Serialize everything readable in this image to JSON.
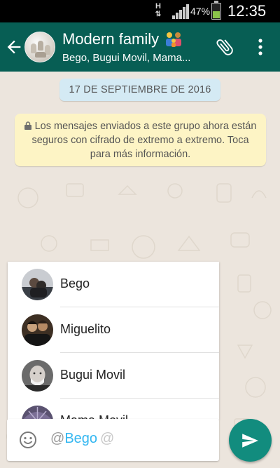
{
  "status_bar": {
    "network": "H",
    "network_arrows": "⇅",
    "battery_percent": "47%",
    "battery_level": 0.47,
    "time": "12:35"
  },
  "header": {
    "back_icon": "arrow-left-icon",
    "title": "Modern family",
    "title_emoji": "family-emoji",
    "subtitle": "Bego, Bugui Movil, Mama...",
    "attach_icon": "paperclip-icon",
    "menu_icon": "more-vert-icon",
    "color": "#075e54"
  },
  "chat": {
    "date_chip": "17 DE SEPTIEMBRE DE 2016",
    "security_notice": "Los mensajes enviados a este grupo ahora están seguros con cifrado de extremo a extremo. Toca para más información.",
    "security_icon": "lock-icon",
    "background": "#ece5dd"
  },
  "mention_list": {
    "items": [
      {
        "label": "Bego"
      },
      {
        "label": "Miguelito"
      },
      {
        "label": "Bugui Movil"
      },
      {
        "label": "Mama Movil"
      }
    ]
  },
  "composer": {
    "emoji_icon": "smiley-icon",
    "at_prefix": "@",
    "mention_text": "Bego",
    "trailing_at": "@",
    "send_icon": "send-icon",
    "send_color": "#128c7e"
  }
}
